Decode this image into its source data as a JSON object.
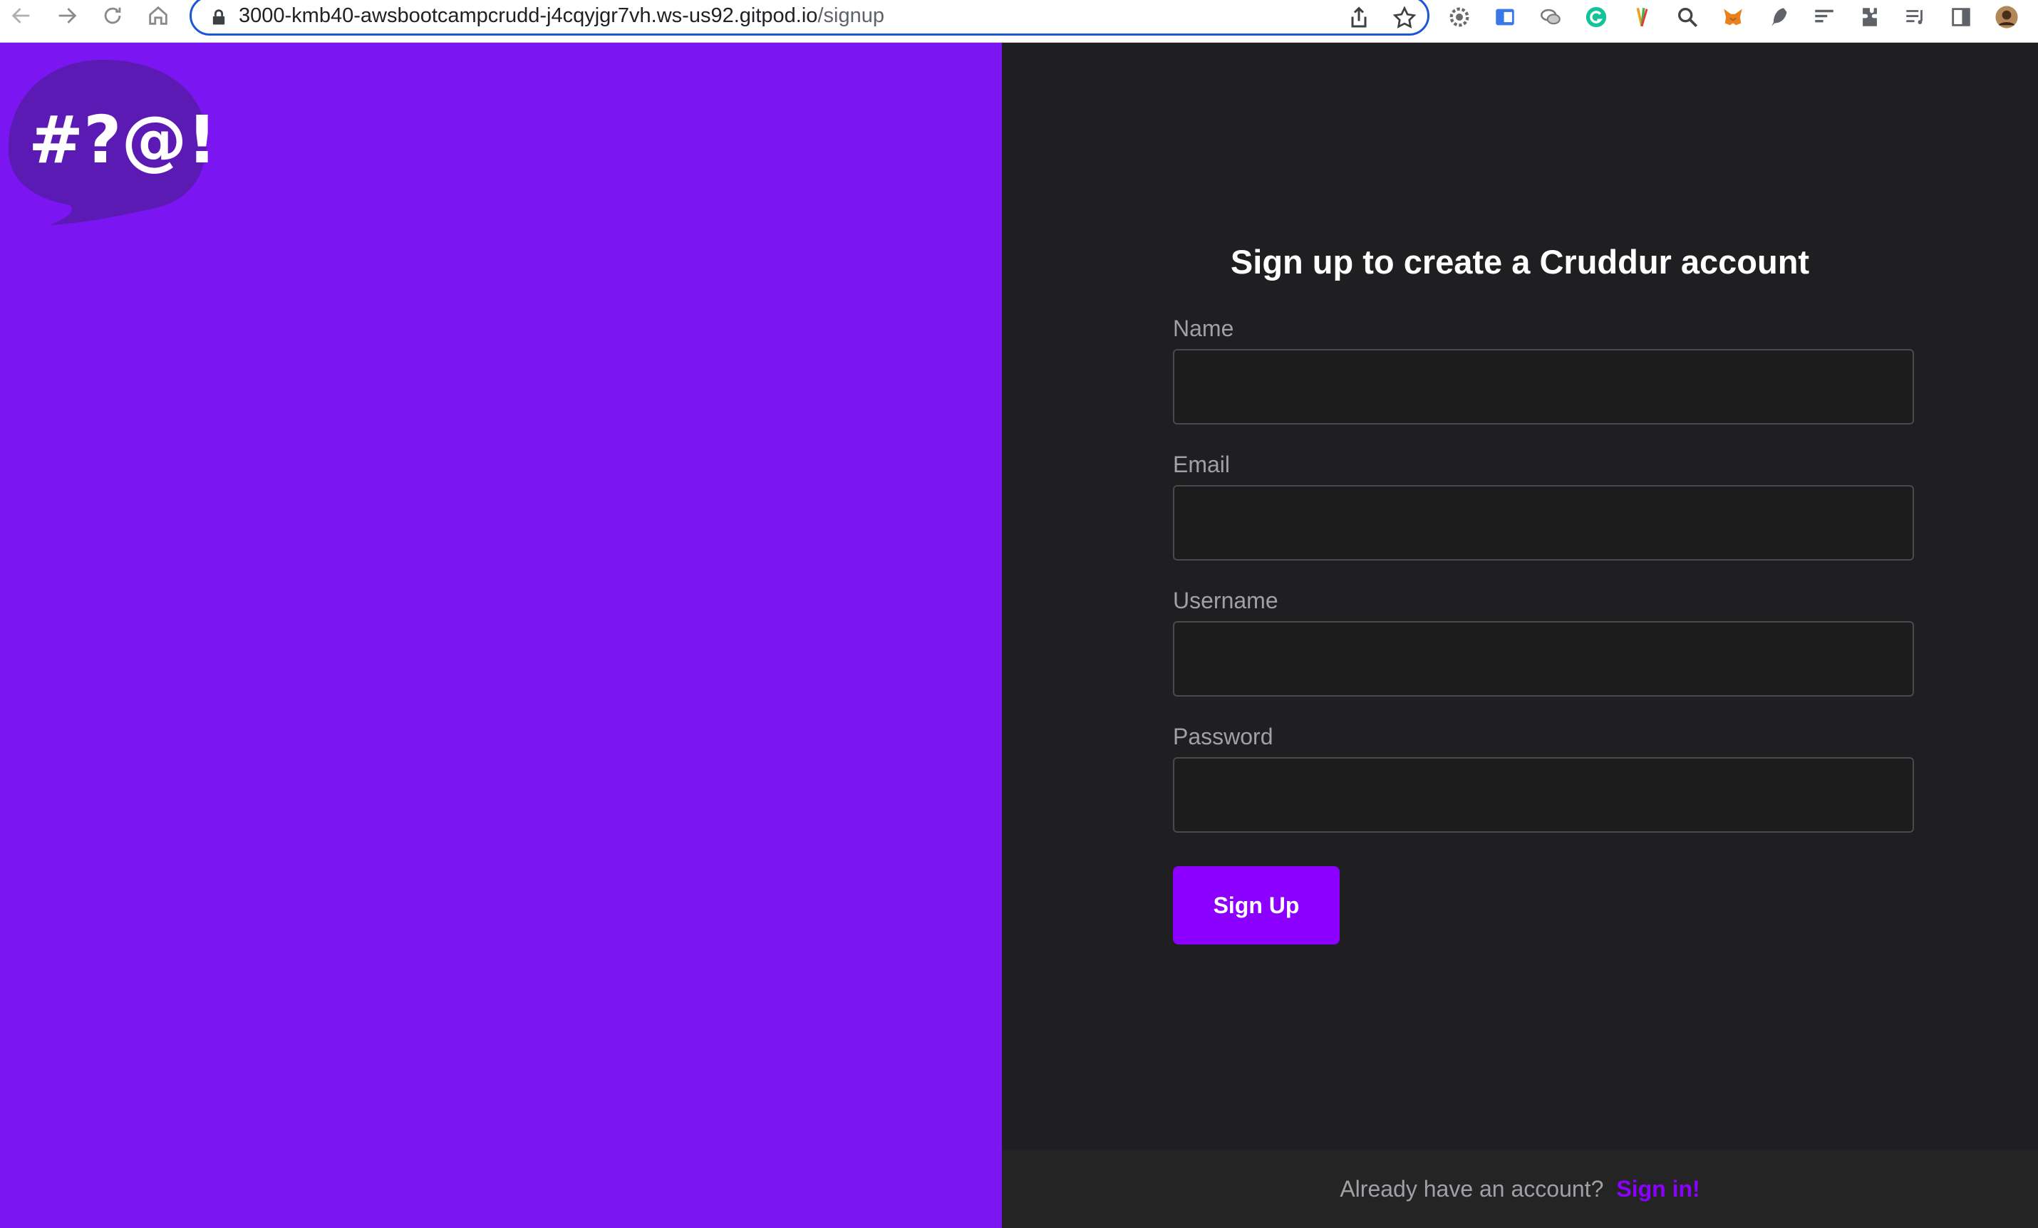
{
  "browser": {
    "url_host": "3000-kmb40-awsbootcampcrudd-j4cqyjgr7vh.ws-us92.gitpod.io",
    "url_path": "/signup",
    "extensions": [
      "settings-gear-icon",
      "translate-icon",
      "chat-bubbles-icon",
      "grammarly-icon",
      "pen-tool-icon",
      "magnifier-icon",
      "metamask-fox-icon",
      "feather-icon",
      "reading-list-icon",
      "puzzle-extensions-icon",
      "media-list-icon",
      "side-panel-icon",
      "profile-avatar"
    ]
  },
  "logo": {
    "text": "#?@!",
    "bubble_color": "#5b1ab3"
  },
  "form": {
    "title": "Sign up to create a Cruddur account",
    "fields": [
      {
        "label": "Name",
        "value": "",
        "placeholder": ""
      },
      {
        "label": "Email",
        "value": "",
        "placeholder": ""
      },
      {
        "label": "Username",
        "value": "",
        "placeholder": ""
      },
      {
        "label": "Password",
        "value": "",
        "placeholder": ""
      }
    ],
    "submit_label": "Sign Up"
  },
  "footer": {
    "prompt": "Already have an account?",
    "link_label": "Sign in!"
  },
  "colors": {
    "brand_purple": "#7b16f3",
    "accent_purple": "#8b00ff",
    "panel_dark": "#1f1f21"
  }
}
